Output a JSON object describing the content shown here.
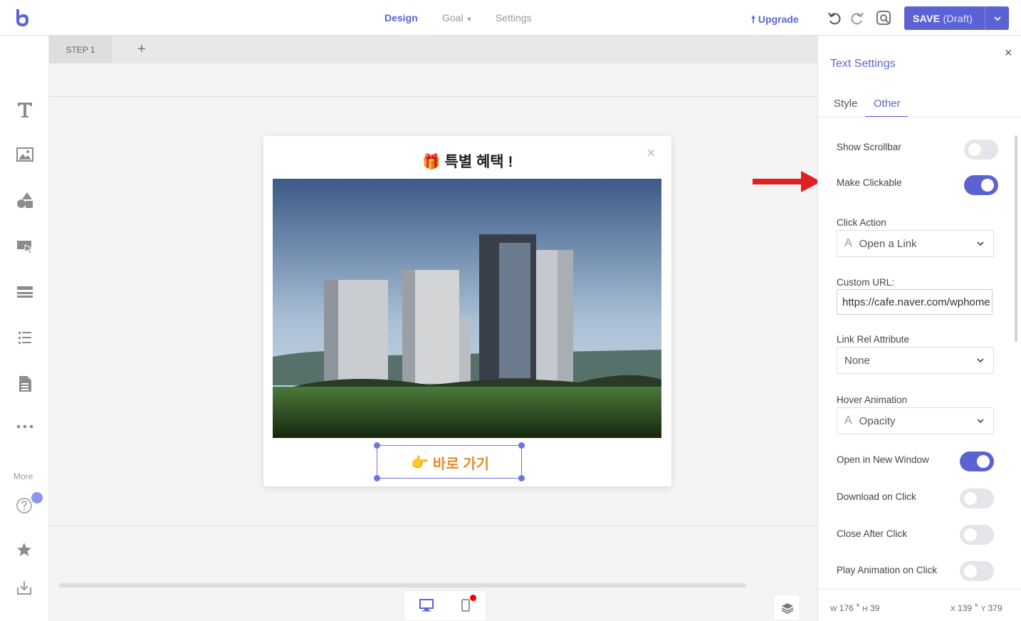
{
  "topbar": {
    "nav": [
      "Design",
      "Goal",
      "Settings"
    ],
    "upgrade": "Upgrade",
    "save": "SAVE",
    "save_state": "(Draft)"
  },
  "sidebar": {
    "more_label": "More"
  },
  "steps": {
    "tab": "STEP 1",
    "add": "+"
  },
  "popup": {
    "title": "특별 혜택 !",
    "close": "×",
    "button_text": "바로 가기"
  },
  "panel": {
    "title": "Text Settings",
    "close": "×",
    "tabs": [
      "Style",
      "Other"
    ],
    "active_tab": "Other",
    "show_scrollbar": {
      "label": "Show Scrollbar",
      "on": false
    },
    "make_clickable": {
      "label": "Make Clickable",
      "on": true
    },
    "click_action": {
      "label": "Click Action",
      "value": "Open a Link",
      "prefix": "A"
    },
    "custom_url": {
      "label": "Custom URL:",
      "value": "https://cafe.naver.com/wphome"
    },
    "link_rel": {
      "label": "Link Rel Attribute",
      "value": "None"
    },
    "hover_animation": {
      "label": "Hover Animation",
      "value": "Opacity",
      "prefix": "A"
    },
    "open_new_window": {
      "label": "Open in New Window",
      "on": true
    },
    "download_on_click": {
      "label": "Download on Click",
      "on": false
    },
    "close_after_click": {
      "label": "Close After Click",
      "on": false
    },
    "play_animation": {
      "label": "Play Animation on Click",
      "on": false
    },
    "footer": {
      "w_label": "W",
      "w": "176",
      "h_label": "H",
      "h": "39",
      "x_label": "X",
      "x": "139",
      "y_label": "Y",
      "y": "379",
      "sep": "×"
    }
  },
  "colors": {
    "accent": "#5b63d4",
    "button_text": "#e48a2f",
    "arrow": "#e02020"
  }
}
